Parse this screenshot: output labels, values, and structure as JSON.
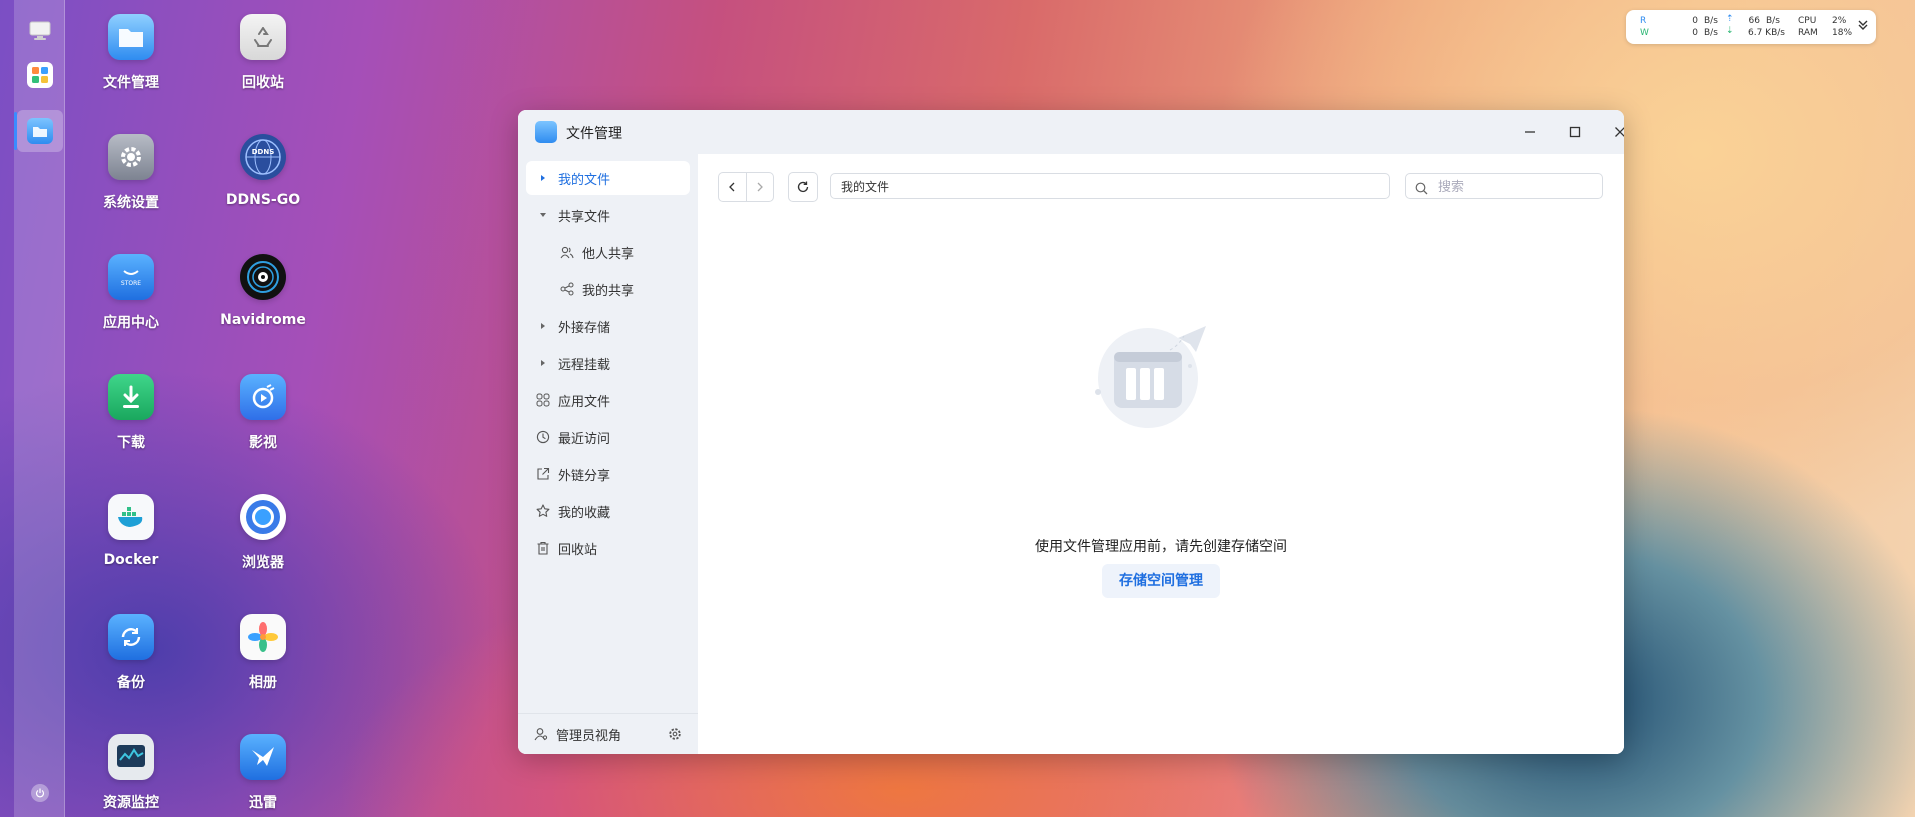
{
  "dock": {
    "items": [
      {
        "name": "desktop"
      },
      {
        "name": "app-grid"
      },
      {
        "name": "file-manager"
      }
    ]
  },
  "desktop": {
    "icons": [
      {
        "label": "文件管理",
        "icon": "folder-icon"
      },
      {
        "label": "回收站",
        "icon": "recycle-bin-icon"
      },
      {
        "label": "系统设置",
        "icon": "settings-gear-icon"
      },
      {
        "label": "DDNS-GO",
        "icon": "ddns-globe-icon"
      },
      {
        "label": "应用中心",
        "icon": "store-bag-icon"
      },
      {
        "label": "Navidrome",
        "icon": "vinyl-record-icon"
      },
      {
        "label": "下载",
        "icon": "download-icon"
      },
      {
        "label": "影视",
        "icon": "video-play-icon"
      },
      {
        "label": "Docker",
        "icon": "docker-whale-icon"
      },
      {
        "label": "浏览器",
        "icon": "browser-icon"
      },
      {
        "label": "备份",
        "icon": "backup-sync-icon"
      },
      {
        "label": "相册",
        "icon": "photos-flower-icon"
      },
      {
        "label": "资源监控",
        "icon": "resource-monitor-icon"
      },
      {
        "label": "迅雷",
        "icon": "thunder-bird-icon"
      }
    ]
  },
  "monitor": {
    "r_label": "R",
    "w_label": "W",
    "r_speed_a": "0",
    "r_unit_a": "B/s",
    "w_speed_a": "0",
    "w_unit_a": "B/s",
    "r_speed_b": "66",
    "r_unit_b": "B/s",
    "w_speed_b": "6.7 KB/s",
    "cpu_label": "CPU",
    "cpu_value": "2%",
    "ram_label": "RAM",
    "ram_value": "18%",
    "upload_color": "#2f8cf0",
    "download_color": "#2bb673"
  },
  "window": {
    "title": "文件管理",
    "sidebar": {
      "items": [
        {
          "label": "我的文件",
          "lead": "caret-right"
        },
        {
          "label": "共享文件",
          "lead": "caret-down"
        },
        {
          "label": "他人共享",
          "lead": "users-icon"
        },
        {
          "label": "我的共享",
          "lead": "share-nodes-icon"
        },
        {
          "label": "外接存储",
          "lead": "caret-right"
        },
        {
          "label": "远程挂载",
          "lead": "caret-right"
        },
        {
          "label": "应用文件",
          "lead": "grid-icon"
        },
        {
          "label": "最近访问",
          "lead": "clock-icon"
        },
        {
          "label": "外链分享",
          "lead": "external-share-icon"
        },
        {
          "label": "我的收藏",
          "lead": "star-icon"
        },
        {
          "label": "回收站",
          "lead": "trash-icon"
        }
      ],
      "admin_label": "管理员视角"
    },
    "toolbar": {
      "path": "我的文件",
      "search_placeholder": "搜索"
    },
    "empty": {
      "message": "使用文件管理应用前，请先创建存储空间",
      "button": "存储空间管理"
    },
    "accent": "#1f6fe0"
  }
}
